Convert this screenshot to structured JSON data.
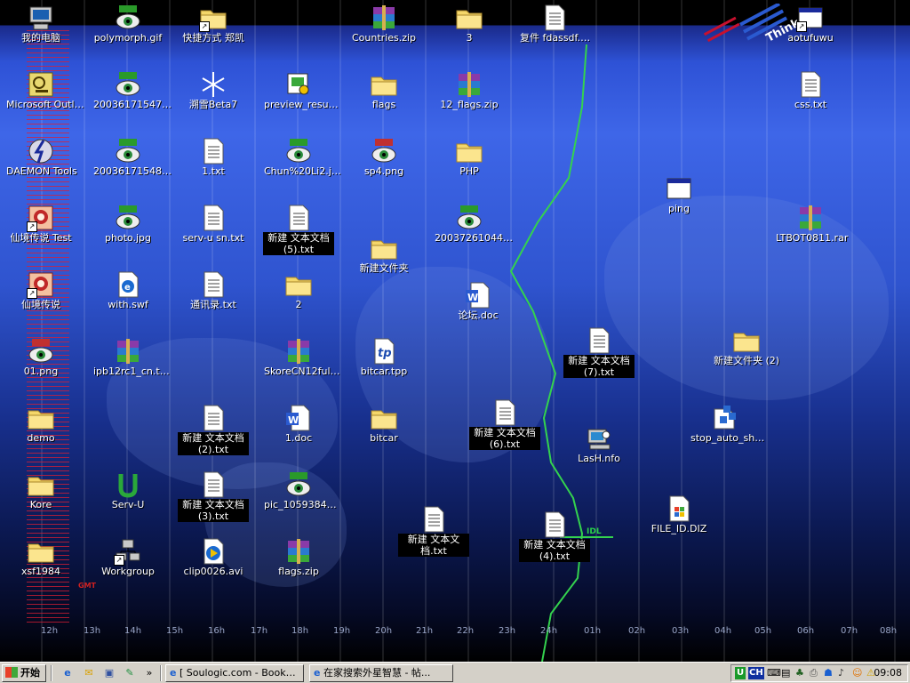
{
  "desktop": {
    "icons": [
      {
        "label": "我的电脑",
        "type": "computer"
      },
      {
        "label": "polymorph.gif",
        "type": "gif"
      },
      {
        "label": "快捷方式 郑凯",
        "type": "folder-shortcut"
      },
      {
        "label": "Countries.zip",
        "type": "rar"
      },
      {
        "label": "3",
        "type": "folder"
      },
      {
        "label": "复件 fdassdf.msg",
        "type": "msg"
      },
      {
        "label": "aotufuwu",
        "type": "window-shortcut"
      },
      {
        "label": "Microsoft Outlook",
        "type": "outlook"
      },
      {
        "label": "2003617154742...",
        "type": "jpg"
      },
      {
        "label": "溯雪Beta7",
        "type": "snowflake"
      },
      {
        "label": "preview_resume...",
        "type": "preview"
      },
      {
        "label": "flags",
        "type": "folder"
      },
      {
        "label": "12_flags.zip",
        "type": "rar"
      },
      {
        "label": "css.txt",
        "type": "txt"
      },
      {
        "label": "DAEMON Tools",
        "type": "daemon"
      },
      {
        "label": "2003617154818...",
        "type": "jpg"
      },
      {
        "label": "1.txt",
        "type": "txt"
      },
      {
        "label": "Chun%20Li2.jpg",
        "type": "jpg"
      },
      {
        "label": "sp4.png",
        "type": "png"
      },
      {
        "label": "PHP",
        "type": "folder"
      },
      {
        "label": "ping",
        "type": "window"
      },
      {
        "label": "仙境传说 Test",
        "type": "game"
      },
      {
        "label": "photo.jpg",
        "type": "jpg"
      },
      {
        "label": "serv-u sn.txt",
        "type": "txt"
      },
      {
        "label": "新建 文本文档 (5).txt",
        "type": "txt"
      },
      {
        "label": "2003726104416...",
        "type": "jpg"
      },
      {
        "label": "LTBOT0811.rar",
        "type": "rar"
      },
      {
        "label": "新建文件夹",
        "type": "folder"
      },
      {
        "label": "仙境传说",
        "type": "game"
      },
      {
        "label": "with.swf",
        "type": "swf"
      },
      {
        "label": "通讯录.txt",
        "type": "txt"
      },
      {
        "label": "2",
        "type": "folder"
      },
      {
        "label": "论坛.doc",
        "type": "doc"
      },
      {
        "label": "01.png",
        "type": "png"
      },
      {
        "label": "ipb12rc1_cn.tar.gz",
        "type": "rar"
      },
      {
        "label": "SkoreCN12full.rar",
        "type": "rar"
      },
      {
        "label": "bitcar.tpp",
        "type": "tpp"
      },
      {
        "label": "新建 文本文档 (7).txt",
        "type": "txt"
      },
      {
        "label": "新建文件夹 (2)",
        "type": "folder"
      },
      {
        "label": "demo",
        "type": "folder"
      },
      {
        "label": "新建 文本文档 (2).txt",
        "type": "txt"
      },
      {
        "label": "1.doc",
        "type": "doc"
      },
      {
        "label": "bitcar",
        "type": "folder"
      },
      {
        "label": "新建 文本文档 (6).txt",
        "type": "txt"
      },
      {
        "label": "LasH.nfo",
        "type": "nfo"
      },
      {
        "label": "stop_auto_shar...",
        "type": "script"
      },
      {
        "label": "Kore",
        "type": "folder"
      },
      {
        "label": "Serv-U",
        "type": "servu"
      },
      {
        "label": "新建 文本文档 (3).txt",
        "type": "txt"
      },
      {
        "label": "pic_1059384099...",
        "type": "jpg"
      },
      {
        "label": "新建 文本文档.txt",
        "type": "txt"
      },
      {
        "label": "新建 文本文档 (4).txt",
        "type": "txt"
      },
      {
        "label": "FILE_ID.DIZ",
        "type": "diz"
      },
      {
        "label": "xsf1984",
        "type": "folder"
      },
      {
        "label": "Workgroup",
        "type": "network"
      },
      {
        "label": "clip0026.avi",
        "type": "avi"
      },
      {
        "label": "flags.zip",
        "type": "rar"
      }
    ],
    "timezone_labels": [
      "12h",
      "13h",
      "14h",
      "15h",
      "16h",
      "17h",
      "18h",
      "19h",
      "20h",
      "21h",
      "22h",
      "23h",
      "24h",
      "01h",
      "02h",
      "03h",
      "04h",
      "05h",
      "06h",
      "07h",
      "08h"
    ],
    "idl_label": "IDL",
    "gmt_label": "GMT"
  },
  "taskbar": {
    "start_label": "开始",
    "tasks": [
      {
        "label": "[ Soulogic.com - Bookmar..."
      },
      {
        "label": "在家搜索外星智慧 - 帖..."
      }
    ],
    "tray": {
      "ime": "CH",
      "time": "09:08"
    }
  }
}
